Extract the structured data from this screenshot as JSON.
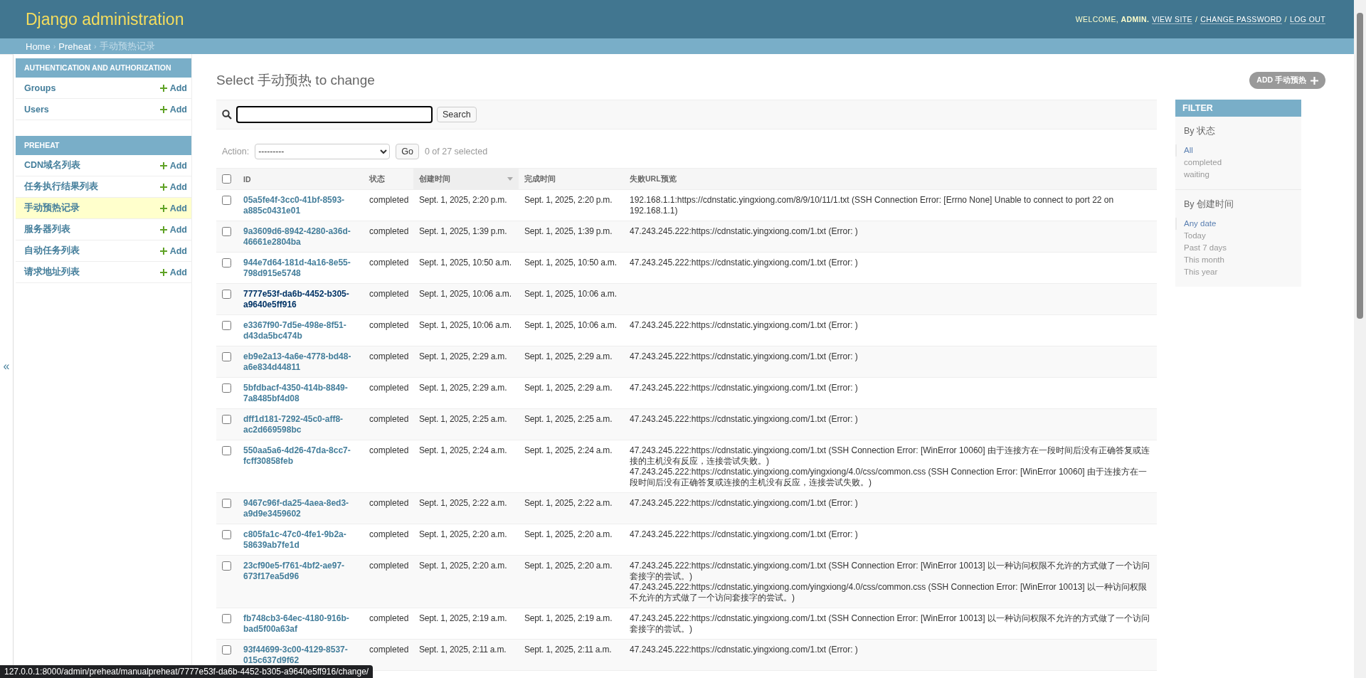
{
  "header": {
    "title": "Django administration",
    "welcome": "WELCOME,",
    "user": "ADMIN.",
    "links": [
      "VIEW SITE",
      "CHANGE PASSWORD",
      "LOG OUT"
    ],
    "link_separator": "/"
  },
  "breadcrumb_separator": "›",
  "breadcrumbs": [
    {
      "label": "Home",
      "link": true
    },
    {
      "label": "Preheat",
      "link": true
    },
    {
      "label": "手动预热记录",
      "link": false
    }
  ],
  "sidebar_toggle": "«",
  "sidebar": {
    "modules": [
      {
        "caption": "AUTHENTICATION AND AUTHORIZATION",
        "items": [
          {
            "label": "Groups",
            "add": "Add",
            "selected": false
          },
          {
            "label": "Users",
            "add": "Add",
            "selected": false
          }
        ]
      },
      {
        "caption": "PREHEAT",
        "items": [
          {
            "label": "CDN域名列表",
            "add": "Add",
            "selected": false
          },
          {
            "label": "任务执行结果列表",
            "add": "Add",
            "selected": false
          },
          {
            "label": "手动预热记录",
            "add": "Add",
            "selected": true
          },
          {
            "label": "服务器列表",
            "add": "Add",
            "selected": false
          },
          {
            "label": "自动任务列表",
            "add": "Add",
            "selected": false
          },
          {
            "label": "请求地址列表",
            "add": "Add",
            "selected": false
          }
        ]
      }
    ]
  },
  "page_title": "Select 手动预热 to change",
  "add_button": "ADD 手动预热",
  "search": {
    "button": "Search"
  },
  "actions": {
    "label": "Action:",
    "select_value": "---------",
    "go": "Go",
    "counter": "0 of 27 selected"
  },
  "table": {
    "select_all_checked": false,
    "columns": [
      {
        "label": "ID",
        "sorted": false
      },
      {
        "label": "状态",
        "sorted": false
      },
      {
        "label": "创建时间",
        "sorted": true
      },
      {
        "label": "完成时间",
        "sorted": false
      },
      {
        "label": "失败URL预览",
        "sorted": false
      }
    ],
    "rows": [
      {
        "checked": false,
        "hovered": false,
        "id": "05a5fe4f-3cc0-41bf-8593-a885c0431e01",
        "status": "completed",
        "created": "Sept. 1, 2025, 2:20 p.m.",
        "finished": "Sept. 1, 2025, 2:20 p.m.",
        "failures": [
          "192.168.1.1:https://cdnstatic.yingxiong.com/8/9/10/11/1.txt (SSH Connection Error: [Errno None] Unable to connect to port 22 on 192.168.1.1)"
        ]
      },
      {
        "checked": false,
        "hovered": false,
        "id": "9a3609d6-8942-4280-a36d-46661e2804ba",
        "status": "completed",
        "created": "Sept. 1, 2025, 1:39 p.m.",
        "finished": "Sept. 1, 2025, 1:39 p.m.",
        "failures": [
          "47.243.245.222:https://cdnstatic.yingxiong.com/1.txt (Error: )"
        ]
      },
      {
        "checked": false,
        "hovered": false,
        "id": "944e7d64-181d-4a16-8e55-798d915e5748",
        "status": "completed",
        "created": "Sept. 1, 2025, 10:50 a.m.",
        "finished": "Sept. 1, 2025, 10:50 a.m.",
        "failures": [
          "47.243.245.222:https://cdnstatic.yingxiong.com/1.txt (Error: )"
        ]
      },
      {
        "checked": false,
        "hovered": true,
        "id": "7777e53f-da6b-4452-b305-a9640e5ff916",
        "status": "completed",
        "created": "Sept. 1, 2025, 10:06 a.m.",
        "finished": "Sept. 1, 2025, 10:06 a.m."
      },
      {
        "checked": false,
        "hovered": false,
        "id": "e3367f90-7d5e-498e-8f51-d43da5bc474b",
        "status": "completed",
        "created": "Sept. 1, 2025, 10:06 a.m.",
        "finished": "Sept. 1, 2025, 10:06 a.m.",
        "failures": [
          "47.243.245.222:https://cdnstatic.yingxiong.com/1.txt (Error: )"
        ]
      },
      {
        "checked": false,
        "hovered": false,
        "id": "eb9e2a13-4a6e-4778-bd48-a6e834d44811",
        "status": "completed",
        "created": "Sept. 1, 2025, 2:29 a.m.",
        "finished": "Sept. 1, 2025, 2:29 a.m.",
        "failures": [
          "47.243.245.222:https://cdnstatic.yingxiong.com/1.txt (Error: )"
        ]
      },
      {
        "checked": false,
        "hovered": false,
        "id": "5bfdbacf-4350-414b-8849-7a8485bf4d08",
        "status": "completed",
        "created": "Sept. 1, 2025, 2:29 a.m.",
        "finished": "Sept. 1, 2025, 2:29 a.m.",
        "failures": [
          "47.243.245.222:https://cdnstatic.yingxiong.com/1.txt (Error: )"
        ]
      },
      {
        "checked": false,
        "hovered": false,
        "id": "dff1d181-7292-45c0-aff8-ac2d669598bc",
        "status": "completed",
        "created": "Sept. 1, 2025, 2:25 a.m.",
        "finished": "Sept. 1, 2025, 2:25 a.m.",
        "failures": [
          "47.243.245.222:https://cdnstatic.yingxiong.com/1.txt (Error: )"
        ]
      },
      {
        "checked": false,
        "hovered": false,
        "id": "550aa5a6-4d26-47da-8cc7-fcff30858feb",
        "status": "completed",
        "created": "Sept. 1, 2025, 2:24 a.m.",
        "finished": "Sept. 1, 2025, 2:24 a.m.",
        "failures": [
          "47.243.245.222:https://cdnstatic.yingxiong.com/1.txt (SSH Connection Error: [WinError 10060] 由于连接方在一段时间后没有正确答复或连接的主机没有反应，连接尝试失败。)",
          "47.243.245.222:https://cdnstatic.yingxiong.com/yingxiong/4.0/css/common.css (SSH Connection Error: [WinError 10060] 由于连接方在一段时间后没有正确答复或连接的主机没有反应，连接尝试失败。)"
        ]
      },
      {
        "checked": false,
        "hovered": false,
        "id": "9467c96f-da25-4aea-8ed3-a9d9e3459602",
        "status": "completed",
        "created": "Sept. 1, 2025, 2:22 a.m.",
        "finished": "Sept. 1, 2025, 2:22 a.m.",
        "failures": [
          "47.243.245.222:https://cdnstatic.yingxiong.com/1.txt (Error: )"
        ]
      },
      {
        "checked": false,
        "hovered": false,
        "id": "c805fa1c-47c0-4fe1-9b2a-58639ab7fe1d",
        "status": "completed",
        "created": "Sept. 1, 2025, 2:20 a.m.",
        "finished": "Sept. 1, 2025, 2:20 a.m.",
        "failures": [
          "47.243.245.222:https://cdnstatic.yingxiong.com/1.txt (Error: )"
        ]
      },
      {
        "checked": false,
        "hovered": false,
        "id": "23cf90e5-f761-4bf2-ae97-673f17ea5d96",
        "status": "completed",
        "created": "Sept. 1, 2025, 2:20 a.m.",
        "finished": "Sept. 1, 2025, 2:20 a.m.",
        "failures": [
          "47.243.245.222:https://cdnstatic.yingxiong.com/1.txt (SSH Connection Error: [WinError 10013] 以一种访问权限不允许的方式做了一个访问套接字的尝试。)",
          "47.243.245.222:https://cdnstatic.yingxiong.com/yingxiong/4.0/css/common.css (SSH Connection Error: [WinError 10013] 以一种访问权限不允许的方式做了一个访问套接字的尝试。)"
        ]
      },
      {
        "checked": false,
        "hovered": false,
        "id": "fb748cb3-64ec-4180-916b-bad5f00a63af",
        "status": "completed",
        "created": "Sept. 1, 2025, 2:19 a.m.",
        "finished": "Sept. 1, 2025, 2:19 a.m.",
        "failures": [
          "47.243.245.222:https://cdnstatic.yingxiong.com/1.txt (SSH Connection Error: [WinError 10013] 以一种访问权限不允许的方式做了一个访问套接字的尝试。)"
        ]
      },
      {
        "checked": false,
        "hovered": false,
        "id": "93f44699-3c00-4129-8537-015c637d9f62",
        "status": "completed",
        "created": "Sept. 1, 2025, 2:11 a.m.",
        "finished": "Sept. 1, 2025, 2:11 a.m.",
        "failures": [
          "47.243.245.222:https://cdnstatic.yingxiong.com/1.txt (Error: )"
        ]
      }
    ]
  },
  "filter": {
    "title": "FILTER",
    "groups": [
      {
        "title": "By 状态",
        "choices": [
          {
            "label": "All",
            "selected": true
          },
          {
            "label": "completed",
            "selected": false
          },
          {
            "label": "waiting",
            "selected": false
          }
        ]
      },
      {
        "title": "By 创建时间",
        "choices": [
          {
            "label": "Any date",
            "selected": true
          },
          {
            "label": "Today",
            "selected": false
          },
          {
            "label": "Past 7 days",
            "selected": false
          },
          {
            "label": "This month",
            "selected": false
          },
          {
            "label": "This year",
            "selected": false
          }
        ]
      }
    ]
  },
  "status_bar": {
    "url": "127.0.0.1:8000/admin/preheat/manualpreheat/7777e53f-da6b-4452-b305-a9640e5ff916/change/"
  }
}
